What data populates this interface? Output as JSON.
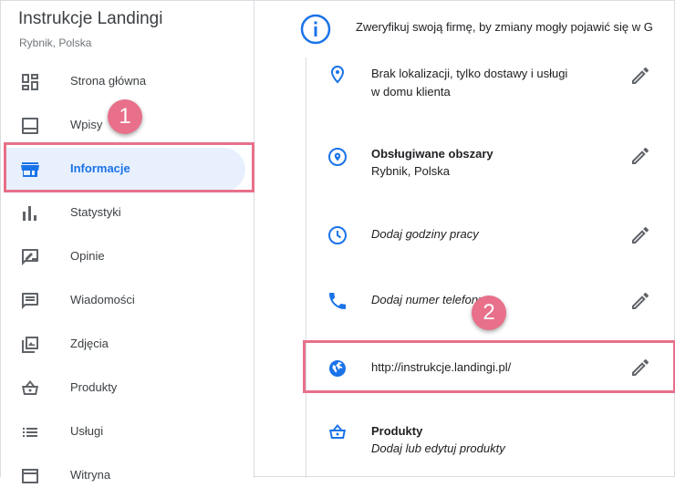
{
  "business": {
    "name": "Instrukcje Landingi",
    "location": "Rybnik, Polska"
  },
  "sidebar": {
    "items": [
      {
        "label": "Strona główna",
        "icon": "dashboard-icon"
      },
      {
        "label": "Wpisy",
        "icon": "posts-icon"
      },
      {
        "label": "Informacje",
        "icon": "store-icon",
        "active": true
      },
      {
        "label": "Statystyki",
        "icon": "bar-chart-icon"
      },
      {
        "label": "Opinie",
        "icon": "reviews-icon"
      },
      {
        "label": "Wiadomości",
        "icon": "messages-icon"
      },
      {
        "label": "Zdjęcia",
        "icon": "photos-icon"
      },
      {
        "label": "Produkty",
        "icon": "basket-icon"
      },
      {
        "label": "Usługi",
        "icon": "list-icon"
      },
      {
        "label": "Witryna",
        "icon": "website-icon"
      }
    ]
  },
  "main": {
    "banner": "Zweryfikuj swoją firmę, by zmiany mogły pojawić się w G",
    "rows": {
      "location": {
        "line1": "Brak lokalizacji, tylko dostawy i usługi",
        "line2": "w domu klienta"
      },
      "areas": {
        "title": "Obsługiwane obszary",
        "value": "Rybnik, Polska"
      },
      "hours": {
        "text": "Dodaj godziny pracy"
      },
      "phone": {
        "text": "Dodaj numer telefonu"
      },
      "website": {
        "text": "http://instrukcje.landingi.pl/"
      },
      "products": {
        "title": "Produkty",
        "text": "Dodaj lub edytuj produkty"
      }
    }
  },
  "annotations": {
    "badge1": "1",
    "badge2": "2",
    "color": "#e8708a"
  },
  "colors": {
    "accent": "#1a73e8",
    "active_bg": "#e8f0fe",
    "text": "#3c4043"
  }
}
